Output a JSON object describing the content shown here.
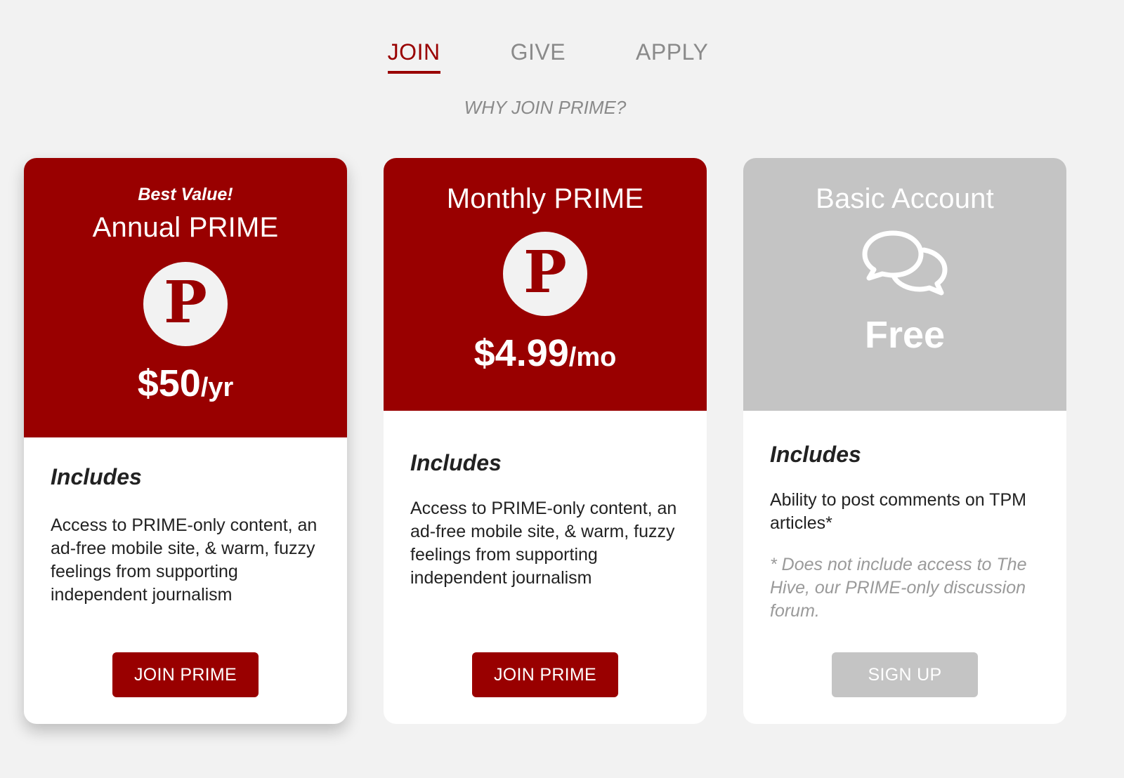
{
  "tabs": [
    {
      "label": "JOIN",
      "active": true
    },
    {
      "label": "GIVE",
      "active": false
    },
    {
      "label": "APPLY",
      "active": false
    }
  ],
  "why_link": "WHY JOIN PRIME?",
  "plans": [
    {
      "badge": "Best Value!",
      "title": "Annual PRIME",
      "icon": "prime-p-logo",
      "logo_letter": "P",
      "price": "$50",
      "period": "/yr",
      "includes_heading": "Includes",
      "description": "Access to PRIME-only content, an ad-free mobile site, & warm, fuzzy feelings from supporting independent journalism",
      "button": "JOIN PRIME"
    },
    {
      "title": "Monthly PRIME",
      "icon": "prime-p-logo",
      "logo_letter": "P",
      "price": "$4.99",
      "period": "/mo",
      "includes_heading": "Includes",
      "description": "Access to PRIME-only content, an ad-free mobile site, & warm, fuzzy feelings from supporting independent journalism",
      "button": "JOIN PRIME"
    },
    {
      "title": "Basic Account",
      "icon": "chat-bubbles-icon",
      "price": "Free",
      "includes_heading": "Includes",
      "description": "Ability to post comments on TPM articles*",
      "note": "* Does not include access to The Hive, our PRIME-only discussion forum.",
      "button": "SIGN UP"
    }
  ],
  "colors": {
    "brand_red": "#990000",
    "muted_grey": "#c4c4c4",
    "page_background": "#f2f2f2"
  }
}
